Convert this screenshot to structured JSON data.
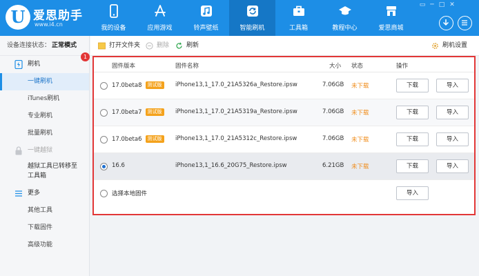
{
  "app": {
    "name": "爱思助手",
    "url": "www.i4.cn"
  },
  "nav": [
    {
      "label": "我的设备",
      "icon": "phone-icon"
    },
    {
      "label": "应用游戏",
      "icon": "appstore-icon"
    },
    {
      "label": "铃声壁纸",
      "icon": "music-icon"
    },
    {
      "label": "智能刷机",
      "icon": "refresh-icon",
      "active": true
    },
    {
      "label": "工具箱",
      "icon": "toolbox-icon"
    },
    {
      "label": "教程中心",
      "icon": "graduation-cap-icon"
    },
    {
      "label": "爱思商城",
      "icon": "store-icon"
    }
  ],
  "sidebar": {
    "status_label": "设备连接状态：",
    "status_value": "正常模式",
    "flash_group": "刷机",
    "items": [
      {
        "label": "一键刷机",
        "active": true
      },
      {
        "label": "iTunes刷机"
      },
      {
        "label": "专业刷机"
      },
      {
        "label": "批量刷机"
      }
    ],
    "jailbreak_group": "一键越狱",
    "jailbreak_notice": "越狱工具已转移至工具箱",
    "more_group": "更多",
    "more_items": [
      {
        "label": "其他工具"
      },
      {
        "label": "下载固件"
      },
      {
        "label": "高级功能"
      }
    ]
  },
  "toolbar": {
    "open_folder": "打开文件夹",
    "delete": "删除",
    "refresh": "刷新",
    "settings": "刷机设置"
  },
  "badge_count": "1",
  "table": {
    "headers": {
      "version": "固件版本",
      "name": "固件名称",
      "size": "大小",
      "status": "状态",
      "action": "操作"
    },
    "rows": [
      {
        "version": "17.0beta8",
        "tag": "测试版",
        "name": "iPhone13,1_17.0_21A5326a_Restore.ipsw",
        "size": "7.06GB",
        "status": "未下载",
        "download": "下载",
        "import": "导入",
        "selected": false
      },
      {
        "version": "17.0beta7",
        "tag": "测试版",
        "name": "iPhone13,1_17.0_21A5319a_Restore.ipsw",
        "size": "7.06GB",
        "status": "未下载",
        "download": "下载",
        "import": "导入",
        "selected": false
      },
      {
        "version": "17.0beta6",
        "tag": "测试版",
        "name": "iPhone13,1_17.0_21A5312c_Restore.ipsw",
        "size": "7.06GB",
        "status": "未下载",
        "download": "下载",
        "import": "导入",
        "selected": false
      },
      {
        "version": "16.6",
        "tag": "",
        "name": "iPhone13,1_16.6_20G75_Restore.ipsw",
        "size": "6.21GB",
        "status": "未下载",
        "download": "下载",
        "import": "导入",
        "selected": true
      }
    ],
    "local": {
      "label": "选择本地固件",
      "import": "导入"
    }
  },
  "colors": {
    "brand": "#1d8ee6",
    "highlight_border": "#e23636",
    "status_orange": "#f08c1a",
    "beta_badge": "#f4a21c"
  }
}
